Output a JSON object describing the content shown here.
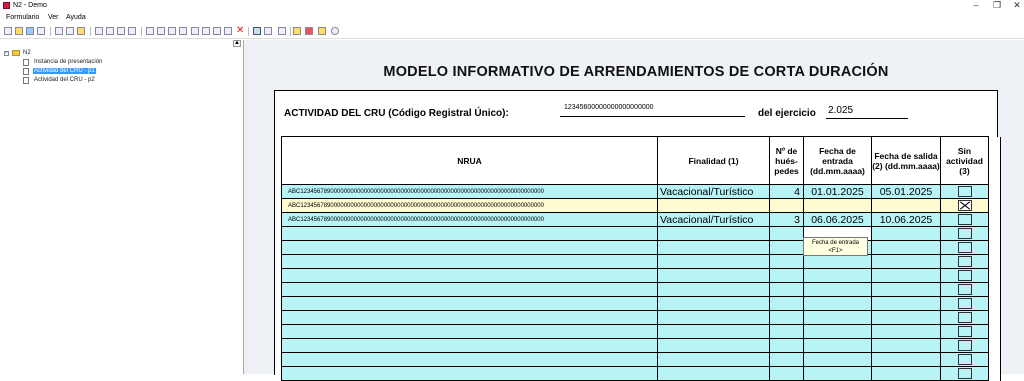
{
  "window": {
    "title": "N2 - Demo",
    "minimize": "–",
    "maximize": "❐",
    "close": "✕"
  },
  "menu": [
    "Formulario",
    "Ver",
    "Ayuda"
  ],
  "toolbar_icons": [
    "new-icon",
    "open-icon",
    "save-icon",
    "print-icon",
    "cut-icon",
    "copy-icon",
    "paste-icon",
    "print-preview-icon",
    "print-all-icon",
    "save-as-icon",
    "pdf-icon",
    "first-icon",
    "prev-icon",
    "next-icon",
    "last-icon",
    "compare-icon",
    "validate-icon",
    "attach-icon",
    "delete-icon",
    "tree-view-icon",
    "grid-view-icon",
    "columns-icon",
    "highlight-icon",
    "record-icon",
    "note-icon",
    "help-icon"
  ],
  "tree": {
    "root": "N2",
    "items": [
      "Instancia de presentación",
      "Actividad del CRU - p1",
      "Actividad del CRU - p2"
    ],
    "selected_index": 1
  },
  "form": {
    "title": "MODELO INFORMATIVO DE ARRENDAMIENTOS DE CORTA DURACIÓN",
    "cru_label": "ACTIVIDAD DEL CRU (Código Registral Único):",
    "cru_value": "12345600000000000000000",
    "ejercicio_label": "del ejercicio",
    "ejercicio_value": "2.025",
    "columns": {
      "nrua": "NRUA",
      "finalidad": "Finalidad (1)",
      "huespedes": "Nº de hués-pedes",
      "entrada": "Fecha de entrada (dd.mm.aaaa)",
      "salida": "Fecha de salida (2) (dd.mm.aaaa)",
      "sin_actividad": "Sin actividad (3)"
    },
    "rows": [
      {
        "nrua": "ABC1234567890000000000000000000000000000000000000000000000000000000000000000",
        "finalidad": "Vacacional/Turístico",
        "huespedes": "4",
        "entrada": "01.01.2025",
        "salida": "05.01.2025",
        "sin_actividad": false
      },
      {
        "nrua": "ABC1234567890000000000000000000000000000000000000000000000000000000000000000",
        "finalidad": "",
        "huespedes": "",
        "entrada": "",
        "salida": "",
        "sin_actividad": true
      },
      {
        "nrua": "ABC1234567890000000000000000000000000000000000000000000000000000000000000000",
        "finalidad": "Vacacional/Turístico",
        "huespedes": "3",
        "entrada": "06.06.2025",
        "salida": "10.06.2025",
        "sin_actividad": false
      }
    ],
    "empty_rows": 11,
    "tooltip": {
      "line1": "Fecha de entrada",
      "line2": "<F1>"
    }
  },
  "colors": {
    "row_fill": "#b8f3f6",
    "selected_row": "#fffbd0",
    "tree_selection": "#3399ff"
  }
}
